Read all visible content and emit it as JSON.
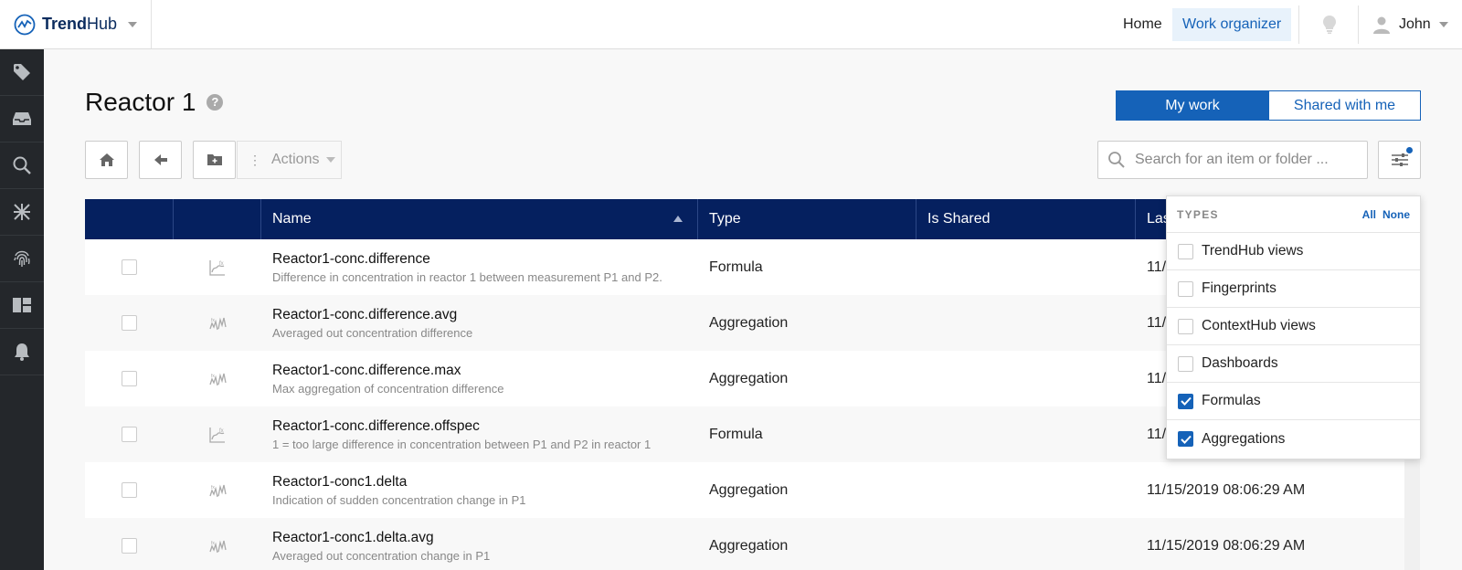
{
  "brand": {
    "name_bold": "Trend",
    "name_rest": "Hub"
  },
  "nav": {
    "home": "Home",
    "work_organizer": "Work organizer",
    "user": "John"
  },
  "sidebar": [
    {
      "icon": "tag-icon"
    },
    {
      "icon": "inbox-icon"
    },
    {
      "icon": "search-icon"
    },
    {
      "icon": "pattern-icon"
    },
    {
      "icon": "fingerprint-icon"
    },
    {
      "icon": "dashboard-icon"
    },
    {
      "icon": "bell-icon"
    }
  ],
  "page": {
    "title": "Reactor 1",
    "help": "?"
  },
  "view_toggle": {
    "my_work": "My work",
    "shared": "Shared with me"
  },
  "toolbar": {
    "actions": "Actions",
    "actions_dots": "⋮"
  },
  "search": {
    "placeholder": "Search for an item or folder ..."
  },
  "table": {
    "columns": [
      "",
      "",
      "Name",
      "Type",
      "Is Shared",
      "Las"
    ],
    "rows": [
      {
        "icon": "formula-icon",
        "name": "Reactor1-conc.difference",
        "desc": "Difference in concentration in reactor 1 between measurement P1 and P2.",
        "type": "Formula",
        "shared": "",
        "last": "11/"
      },
      {
        "icon": "aggregation-icon",
        "name": "Reactor1-conc.difference.avg",
        "desc": "Averaged out concentration difference",
        "type": "Aggregation",
        "shared": "",
        "last": "11/"
      },
      {
        "icon": "aggregation-icon",
        "name": "Reactor1-conc.difference.max",
        "desc": "Max aggregation of concentration difference",
        "type": "Aggregation",
        "shared": "",
        "last": "11/"
      },
      {
        "icon": "formula-icon",
        "name": "Reactor1-conc.difference.offspec",
        "desc": "1 = too large difference in concentration between P1 and P2 in reactor 1",
        "type": "Formula",
        "shared": "",
        "last": "11/"
      },
      {
        "icon": "aggregation-icon",
        "name": "Reactor1-conc1.delta",
        "desc": "Indication of sudden concentration change in P1",
        "type": "Aggregation",
        "shared": "",
        "last": "11/15/2019 08:06:29 AM"
      },
      {
        "icon": "aggregation-icon",
        "name": "Reactor1-conc1.delta.avg",
        "desc": "Averaged out concentration change in P1",
        "type": "Aggregation",
        "shared": "",
        "last": "11/15/2019 08:06:29 AM"
      }
    ]
  },
  "filter": {
    "label": "TYPES",
    "all": "All",
    "none": "None",
    "items": [
      {
        "label": "TrendHub views",
        "checked": false
      },
      {
        "label": "Fingerprints",
        "checked": false
      },
      {
        "label": "ContextHub views",
        "checked": false
      },
      {
        "label": "Dashboards",
        "checked": false
      },
      {
        "label": "Formulas",
        "checked": true
      },
      {
        "label": "Aggregations",
        "checked": true
      }
    ]
  },
  "colors": {
    "accent": "#1562b8",
    "header": "#05205f",
    "sidebar": "#24272b"
  }
}
